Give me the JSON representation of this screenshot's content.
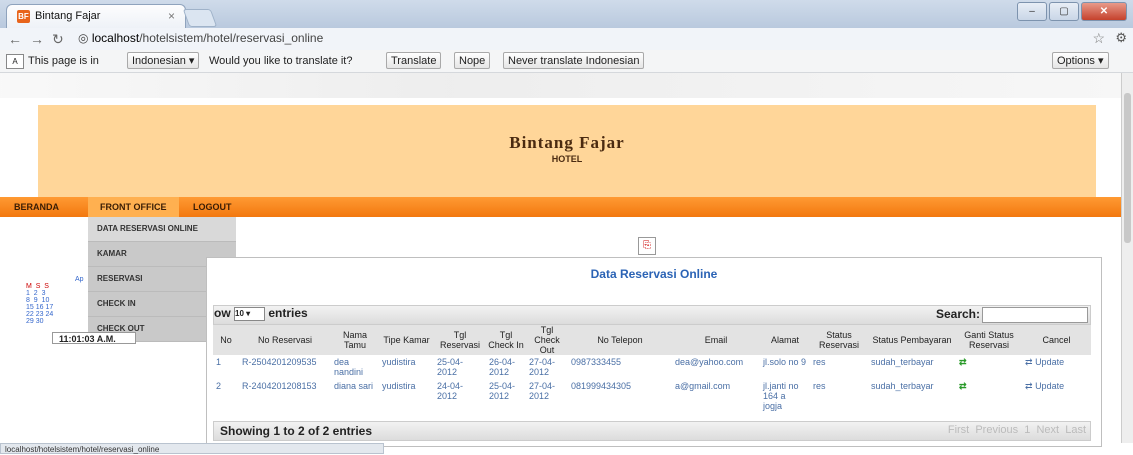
{
  "browser": {
    "tab_title": "Bintang Fajar",
    "tab_close": "×",
    "favicon_text": "BF",
    "url_host": "localhost",
    "url_path": "/hotelsistem/hotel/reservasi_online"
  },
  "translate_bar": {
    "prefix": "This page is in",
    "language": "Indonesian ▾",
    "question": "Would you like to translate it?",
    "translate": "Translate",
    "nope": "Nope",
    "never": "Never translate Indonesian",
    "options": "Options ▾"
  },
  "banner": {
    "title": "Bintang Fajar",
    "subtitle": "HOTEL"
  },
  "menu": {
    "home": "BERANDA",
    "front_office": "FRONT OFFICE",
    "logout": "LOGOUT"
  },
  "dropdown": [
    "DATA RESERVASI ONLINE",
    "KAMAR",
    "RESERVASI",
    "CHECK IN",
    "CHECK OUT"
  ],
  "calendar": {
    "month": "Ap",
    "row1": "M  S  S",
    "row2": "1  2  3",
    "row3": "8  9  10",
    "row4": "15 16 17",
    "row5": "22 23 24",
    "row6": "29 30"
  },
  "clock": "11:01:03 A.M.",
  "panel_title": "Data Reservasi Online",
  "length": {
    "show": "ow",
    "value": "10 ▾",
    "entries": "entries"
  },
  "search_label": "Search:",
  "columns": [
    "No",
    "No Reservasi",
    "Nama Tamu",
    "Tipe Kamar",
    "Tgl Reservasi",
    "Tgl Check In",
    "Tgl Check Out",
    "No Telepon",
    "Email",
    "Alamat",
    "Status Reservasi",
    "Status Pembayaran",
    "Ganti Status Reservasi",
    "Cancel"
  ],
  "rows": [
    {
      "no": "1",
      "reservasi": "R-2504201209535",
      "nama": "dea nandini",
      "tipe": "yudistira",
      "tgl": "25-04-2012",
      "in": "26-04-2012",
      "out": "27-04-2012",
      "telp": "0987333455",
      "email": "dea@yahoo.com",
      "alamat": "jl.solo no 9",
      "status": "res",
      "bayar": "sudah_terbayar",
      "cancel": "Update"
    },
    {
      "no": "2",
      "reservasi": "R-2404201208153",
      "nama": "diana sari",
      "tipe": "yudistira",
      "tgl": "24-04-2012",
      "in": "25-04-2012",
      "out": "27-04-2012",
      "telp": "081999434305",
      "email": "a@gmail.com",
      "alamat": "jl.janti no 164 a jogja",
      "status": "res",
      "bayar": "sudah_terbayar",
      "cancel": "Update"
    }
  ],
  "info": "Showing 1 to 2 of 2 entries",
  "pager": "First  Previous  1  Next  Last",
  "statusbar": "localhost/hotelsistem/hotel/reservasi_online"
}
